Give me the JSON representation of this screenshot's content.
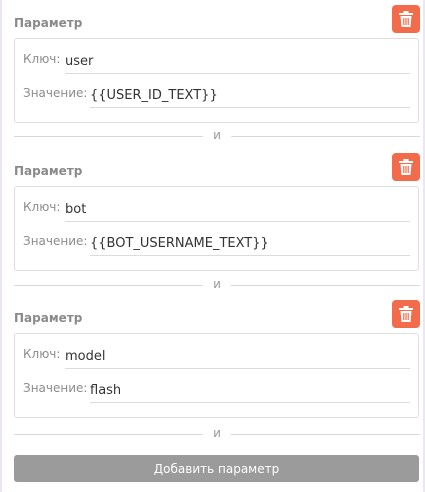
{
  "params": [
    {
      "title": "Параметр",
      "key_label": "Ключ:",
      "key_value": "user",
      "value_label": "Значение:",
      "value_value": "{{USER_ID_TEXT}}"
    },
    {
      "title": "Параметр",
      "key_label": "Ключ:",
      "key_value": "bot",
      "value_label": "Значение:",
      "value_value": "{{BOT_USERNAME_TEXT}}"
    },
    {
      "title": "Параметр",
      "key_label": "Ключ:",
      "key_value": "model",
      "value_label": "Значение:",
      "value_value": "flash"
    }
  ],
  "separator_text": "и",
  "add_button_label": "Добавить параметр",
  "icons": {
    "delete": "trash-icon"
  },
  "colors": {
    "delete_button": "#f26b4a",
    "add_button": "#9b9b9b"
  }
}
